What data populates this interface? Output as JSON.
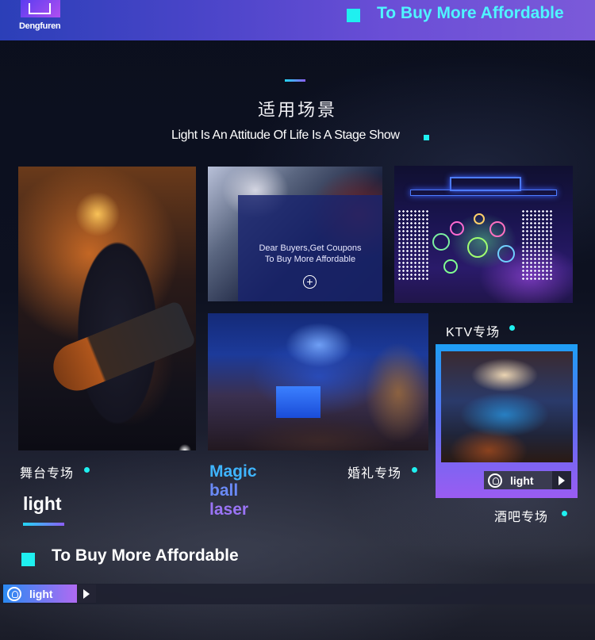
{
  "header": {
    "logo_text": "Dengfuren",
    "slogan": "To Buy More Affordable"
  },
  "section": {
    "title": "适用场景",
    "subtitle": "Light Is An Attitude Of Life Is A Stage Show"
  },
  "promo": {
    "line1": "Dear Buyers,Get Coupons",
    "line2": "To Buy More Affordable",
    "plus": "+"
  },
  "scenes": {
    "stage": "舞台专场",
    "wedding": "婚礼专场",
    "ktv": "KTV专场",
    "bar": "酒吧专场"
  },
  "brand_word": "light",
  "magic": [
    "Magic",
    "ball",
    "laser"
  ],
  "product_pill": {
    "label": "light",
    "icon": "bulb-icon"
  },
  "bottom": {
    "slogan": "To Buy More Affordable",
    "pill_label": "light"
  },
  "colors": {
    "accent_cyan": "#1ff0f0",
    "header_gradient_start": "#2b3fb8",
    "header_gradient_end": "#7b5ad9",
    "magic_blue": "#3fb5ff",
    "magic_purple": "#9a74f5"
  }
}
